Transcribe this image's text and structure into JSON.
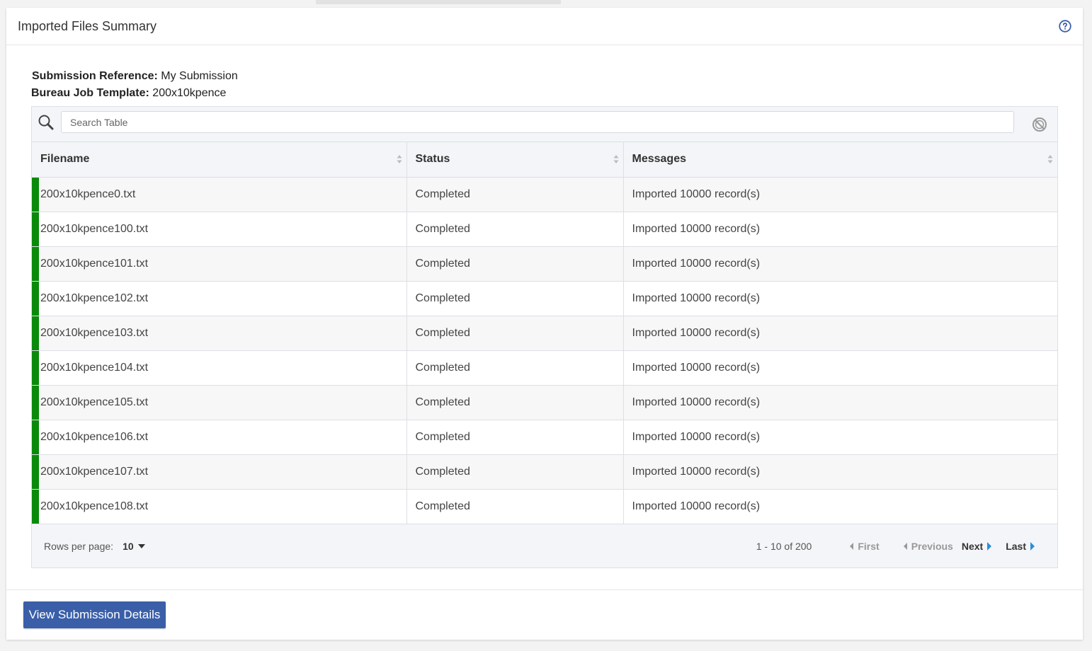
{
  "panel": {
    "title": "Imported Files Summary"
  },
  "meta": {
    "submission_reference_label": "Submission Reference:",
    "submission_reference_value": "My Submission",
    "job_template_label": "Bureau Job Template:",
    "job_template_value": "200x10kpence"
  },
  "search": {
    "placeholder": "Search Table"
  },
  "table": {
    "columns": [
      "Filename",
      "Status",
      "Messages"
    ],
    "rows": [
      {
        "filename": "200x10kpence0.txt",
        "status": "Completed",
        "message": "Imported 10000 record(s)"
      },
      {
        "filename": "200x10kpence100.txt",
        "status": "Completed",
        "message": "Imported 10000 record(s)"
      },
      {
        "filename": "200x10kpence101.txt",
        "status": "Completed",
        "message": "Imported 10000 record(s)"
      },
      {
        "filename": "200x10kpence102.txt",
        "status": "Completed",
        "message": "Imported 10000 record(s)"
      },
      {
        "filename": "200x10kpence103.txt",
        "status": "Completed",
        "message": "Imported 10000 record(s)"
      },
      {
        "filename": "200x10kpence104.txt",
        "status": "Completed",
        "message": "Imported 10000 record(s)"
      },
      {
        "filename": "200x10kpence105.txt",
        "status": "Completed",
        "message": "Imported 10000 record(s)"
      },
      {
        "filename": "200x10kpence106.txt",
        "status": "Completed",
        "message": "Imported 10000 record(s)"
      },
      {
        "filename": "200x10kpence107.txt",
        "status": "Completed",
        "message": "Imported 10000 record(s)"
      },
      {
        "filename": "200x10kpence108.txt",
        "status": "Completed",
        "message": "Imported 10000 record(s)"
      }
    ]
  },
  "pagination": {
    "rows_per_page_label": "Rows per page:",
    "rows_per_page_value": "10",
    "range": "1 - 10 of 200",
    "first": "First",
    "previous": "Previous",
    "next": "Next",
    "last": "Last"
  },
  "footer": {
    "view_details_label": "View Submission Details"
  },
  "colors": {
    "status_completed": "#0a8a0a",
    "primary_button": "#3a5fa8",
    "pager_arrow_active": "#2a8fd8"
  }
}
